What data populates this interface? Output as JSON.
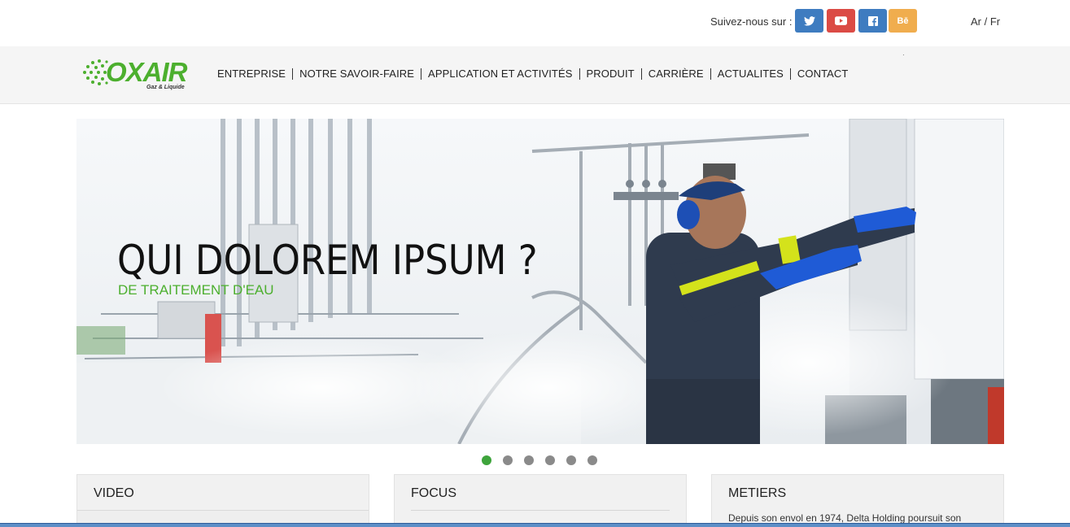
{
  "header": {
    "follow_label": "Suivez-nous sur :",
    "social": [
      {
        "name": "twitter",
        "glyph": "🐦",
        "color": "#3e7cc0"
      },
      {
        "name": "youtube",
        "glyph": "▶",
        "color": "#db4b45"
      },
      {
        "name": "facebook",
        "glyph": "f",
        "color": "#3e7cc0"
      },
      {
        "name": "behance",
        "glyph": "Bē",
        "color": "#f0ad4e"
      }
    ],
    "lang": "Ar / Fr"
  },
  "logo": {
    "name": "OXAIR",
    "tagline": "Gaz & Liquide",
    "color": "#4caf2e"
  },
  "nav": {
    "items": [
      "ENTREPRISE",
      "NOTRE SAVOIR-FAIRE",
      "APPLICATION ET ACTIVITÉS",
      "PRODUIT",
      "CARRIÈRE",
      "ACTUALITES",
      "CONTACT"
    ]
  },
  "slider": {
    "title": "QUI DOLOREM IPSUM ?",
    "subtitle": "DE TRAITEMENT D'EAU",
    "slide_count": 6,
    "active_index": 0
  },
  "panels": [
    {
      "title": "VIDEO",
      "text": ""
    },
    {
      "title": "FOCUS",
      "text": ""
    },
    {
      "title": "METIERS",
      "text": "Depuis son envol en 1974, Delta Holding poursuit son"
    }
  ]
}
